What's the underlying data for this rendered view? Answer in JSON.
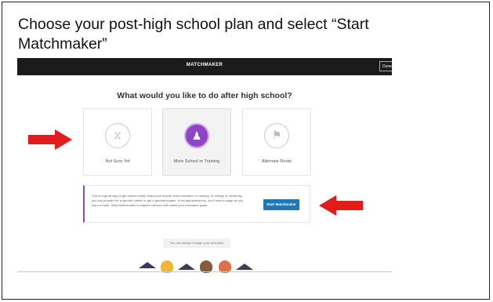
{
  "slide": {
    "title": "Choose your post-high school plan and select “Start Matchmaker”"
  },
  "app": {
    "topbar_title": "MATCHMAKER",
    "done_label": "Done",
    "question": "What would you like to do after high school?",
    "options": [
      {
        "label": "Not Sure Yet",
        "icon": "hourglass-icon",
        "glyph": "⧖",
        "selected": false
      },
      {
        "label": "More School or Training",
        "icon": "graduate-icon",
        "glyph": "♟",
        "selected": true
      },
      {
        "label": "Alternate Route",
        "icon": "signpost-icon",
        "glyph": "⚑",
        "selected": false
      }
    ],
    "info_text": "This is a great way to get career-ready! Many jobs require extra education or training. In college or university, you can prepare for a specific career or get a general degree. In an apprenticeship, you'll earn a wage as you learn a trade. Start Matchmaker to explore careers that match your education goals.",
    "start_button": "Start Matchmaker",
    "change_note": "You can always change your selection!"
  },
  "colors": {
    "accent_purple": "#8e44c8",
    "button_blue": "#1f78b4",
    "arrow_red": "#e21b1b",
    "topbar": "#1b1b1b"
  }
}
